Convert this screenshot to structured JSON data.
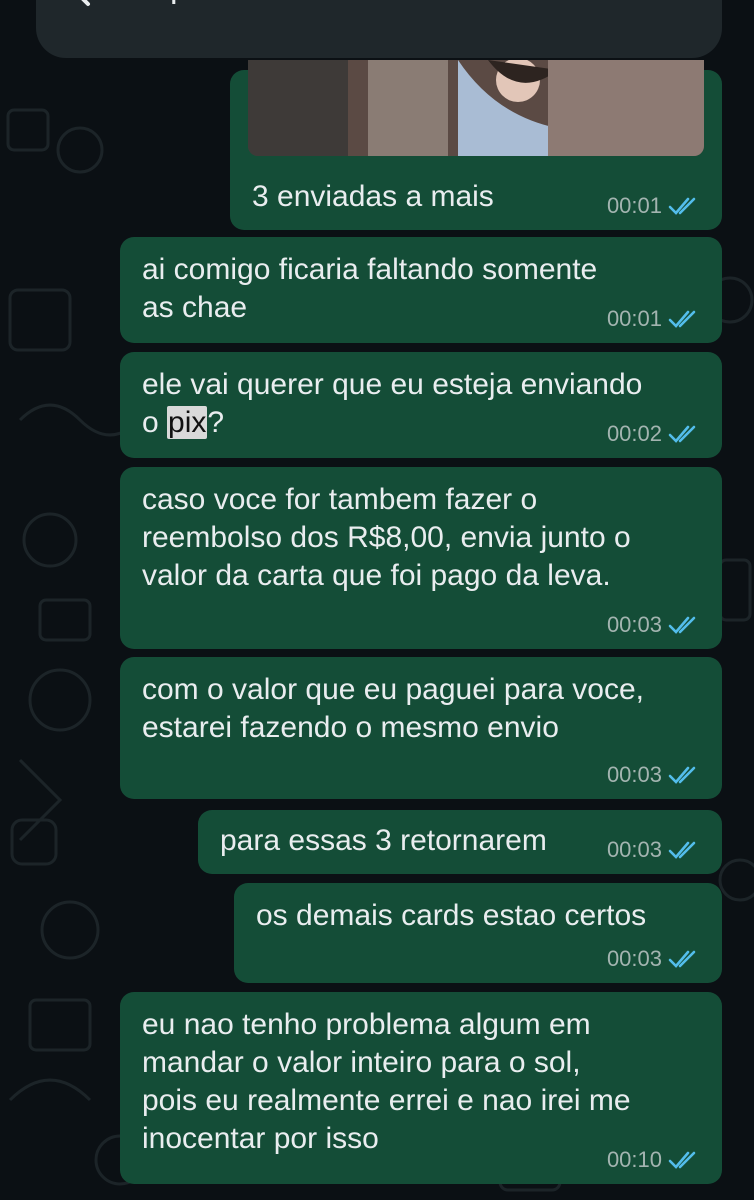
{
  "search": {
    "query": "pix",
    "back_icon": "arrow-left-icon",
    "up_icon": "chevron-up-icon",
    "down_icon": "chevron-down-icon"
  },
  "colors": {
    "background": "#0b1014",
    "outgoing_bubble": "#144d37",
    "text": "#e9edef",
    "time": "#a3b4b0",
    "read_ticks": "#53bdeb",
    "highlight": "#d9d9d9"
  },
  "messages": [
    {
      "text": "3 enviadas a mais",
      "time": "00:01",
      "status": "read",
      "has_image": true
    },
    {
      "lines": [
        "ai comigo ficaria faltando somente",
        "as chae"
      ],
      "time": "00:01",
      "status": "read"
    },
    {
      "line1": "ele vai querer que eu esteja enviando",
      "line2_before": "o ",
      "line2_match": "pix",
      "line2_after": "?",
      "time": "00:02",
      "status": "read"
    },
    {
      "lines": [
        "caso voce for tambem fazer o",
        "reembolso dos R$8,00, envia junto o",
        "valor da carta que foi pago da leva."
      ],
      "time": "00:03",
      "status": "read"
    },
    {
      "lines": [
        "com o valor que eu paguei para voce,",
        "estarei fazendo o mesmo envio"
      ],
      "time": "00:03",
      "status": "read"
    },
    {
      "text": "para essas 3 retornarem",
      "time": "00:03",
      "status": "read"
    },
    {
      "text": "os demais cards estao certos",
      "time": "00:03",
      "status": "read"
    },
    {
      "lines": [
        "eu nao tenho problema algum em",
        "mandar o valor inteiro para o sol,",
        "pois eu realmente errei e nao irei me",
        "inocentar por isso"
      ],
      "time": "00:10",
      "status": "read"
    }
  ]
}
